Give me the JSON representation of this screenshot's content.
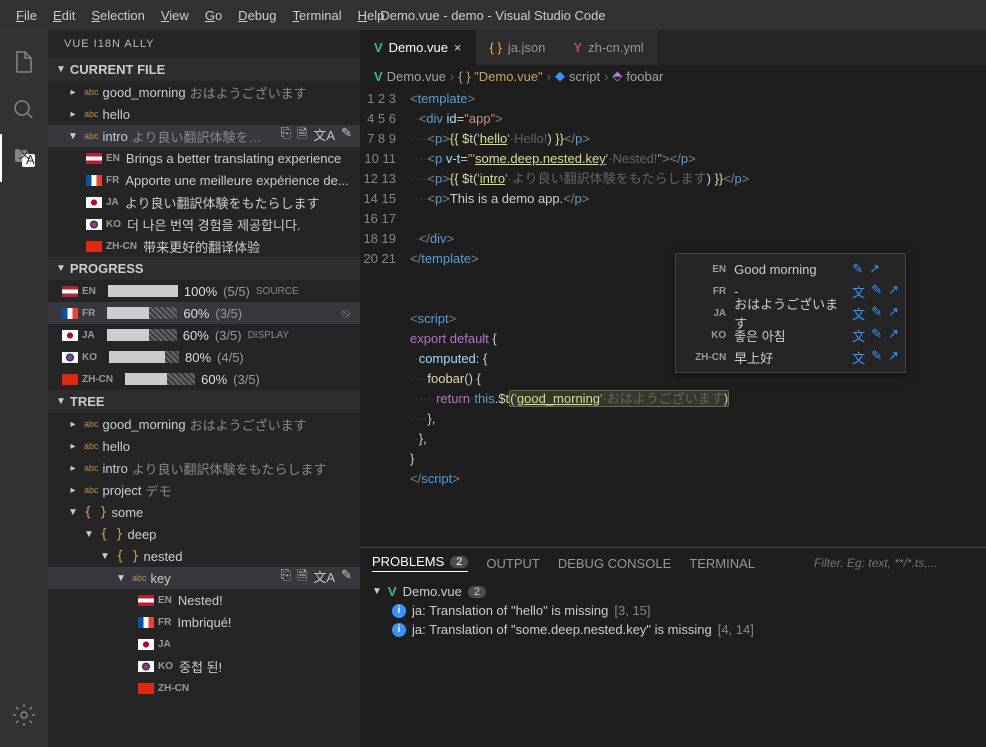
{
  "window_title": "Demo.vue - demo - Visual Studio Code",
  "menu": [
    "File",
    "Edit",
    "Selection",
    "View",
    "Go",
    "Debug",
    "Terminal",
    "Help"
  ],
  "sidebar_title": "VUE I18N ALLY",
  "sections": {
    "current_file": "CURRENT FILE",
    "progress": "PROGRESS",
    "tree": "TREE"
  },
  "current_file": [
    {
      "key": "good_morning",
      "hint": "おはようございます"
    },
    {
      "key": "hello",
      "hint": ""
    },
    {
      "key": "intro",
      "hint": "より良い翻訳体験を…",
      "selected": true,
      "expanded": true
    }
  ],
  "intro_trans": [
    {
      "lc": "EN",
      "flag": "us",
      "text": "Brings a better translating experience"
    },
    {
      "lc": "FR",
      "flag": "fr",
      "text": "Apporte une meilleure expérience de..."
    },
    {
      "lc": "JA",
      "flag": "jp",
      "text": "より良い翻訳体験をもたらします"
    },
    {
      "lc": "KO",
      "flag": "kr",
      "text": "더 나은 번역 경험을 제공합니다."
    },
    {
      "lc": "ZH-CN",
      "flag": "cn",
      "text": "带来更好的翻译体验"
    }
  ],
  "progress": [
    {
      "lc": "EN",
      "flag": "us",
      "pct": "100%",
      "frac": "(5/5)",
      "tag": "SOURCE",
      "fill": 100
    },
    {
      "lc": "FR",
      "flag": "fr",
      "pct": "60%",
      "frac": "(3/5)",
      "tag": "",
      "fill": 60,
      "selected": true,
      "eye": true
    },
    {
      "lc": "JA",
      "flag": "jp",
      "pct": "60%",
      "frac": "(3/5)",
      "tag": "DISPLAY",
      "fill": 60
    },
    {
      "lc": "KO",
      "flag": "kr",
      "pct": "80%",
      "frac": "(4/5)",
      "tag": "",
      "fill": 80
    },
    {
      "lc": "ZH-CN",
      "flag": "cn",
      "pct": "60%",
      "frac": "(3/5)",
      "tag": "",
      "fill": 60
    }
  ],
  "tree": [
    {
      "key": "good_morning",
      "hint": "おはようございます"
    },
    {
      "key": "hello",
      "hint": ""
    },
    {
      "key": "intro",
      "hint": "より良い翻訳体験をもたらします"
    },
    {
      "key": "project",
      "hint": "デモ"
    }
  ],
  "tree_nested_label": "some",
  "tree_deep_label": "deep",
  "tree_nested2_label": "nested",
  "tree_key_label": "key",
  "tree_key_trans": [
    {
      "lc": "EN",
      "flag": "us",
      "text": "Nested!"
    },
    {
      "lc": "FR",
      "flag": "fr",
      "text": "Imbriqué!"
    },
    {
      "lc": "JA",
      "flag": "jp",
      "text": ""
    },
    {
      "lc": "KO",
      "flag": "kr",
      "text": "중첩 된!"
    },
    {
      "lc": "ZH-CN",
      "flag": "cn",
      "text": ""
    }
  ],
  "tabs": [
    {
      "label": "Demo.vue",
      "icon": "V",
      "active": true,
      "close": true
    },
    {
      "label": "ja.json",
      "icon": "{}",
      "color": "#e8b339"
    },
    {
      "label": "zh-cn.yml",
      "icon": "Y",
      "color": "#cb4b4b"
    }
  ],
  "breadcrumb": [
    "Demo.vue",
    "{ } \"Demo.vue\"",
    "script",
    "foobar"
  ],
  "code_lines": 21,
  "tooltip": [
    {
      "lc": "EN",
      "text": "Good morning",
      "icons": [
        "pen",
        "arr"
      ]
    },
    {
      "lc": "FR",
      "text": "-",
      "icons": [
        "cn",
        "pen",
        "arr"
      ]
    },
    {
      "lc": "JA",
      "text": "おはようございます",
      "icons": [
        "cn",
        "pen",
        "arr"
      ]
    },
    {
      "lc": "KO",
      "text": "좋은 아침",
      "icons": [
        "cn",
        "pen",
        "arr"
      ]
    },
    {
      "lc": "ZH-CN",
      "text": "早上好",
      "icons": [
        "cn",
        "pen",
        "arr"
      ]
    }
  ],
  "panel_tabs": {
    "problems": "PROBLEMS",
    "problems_count": "2",
    "output": "OUTPUT",
    "debug": "DEBUG CONSOLE",
    "terminal": "TERMINAL"
  },
  "filter_placeholder": "Filter. Eg: text, **/*.ts,...",
  "problems_file": "Demo.vue",
  "problems_file_count": "2",
  "problems": [
    {
      "msg": "ja: Translation of \"hello\" is missing",
      "loc": "[3, 15]"
    },
    {
      "msg": "ja: Translation of \"some.deep.nested.key\" is missing",
      "loc": "[4, 14]"
    }
  ]
}
